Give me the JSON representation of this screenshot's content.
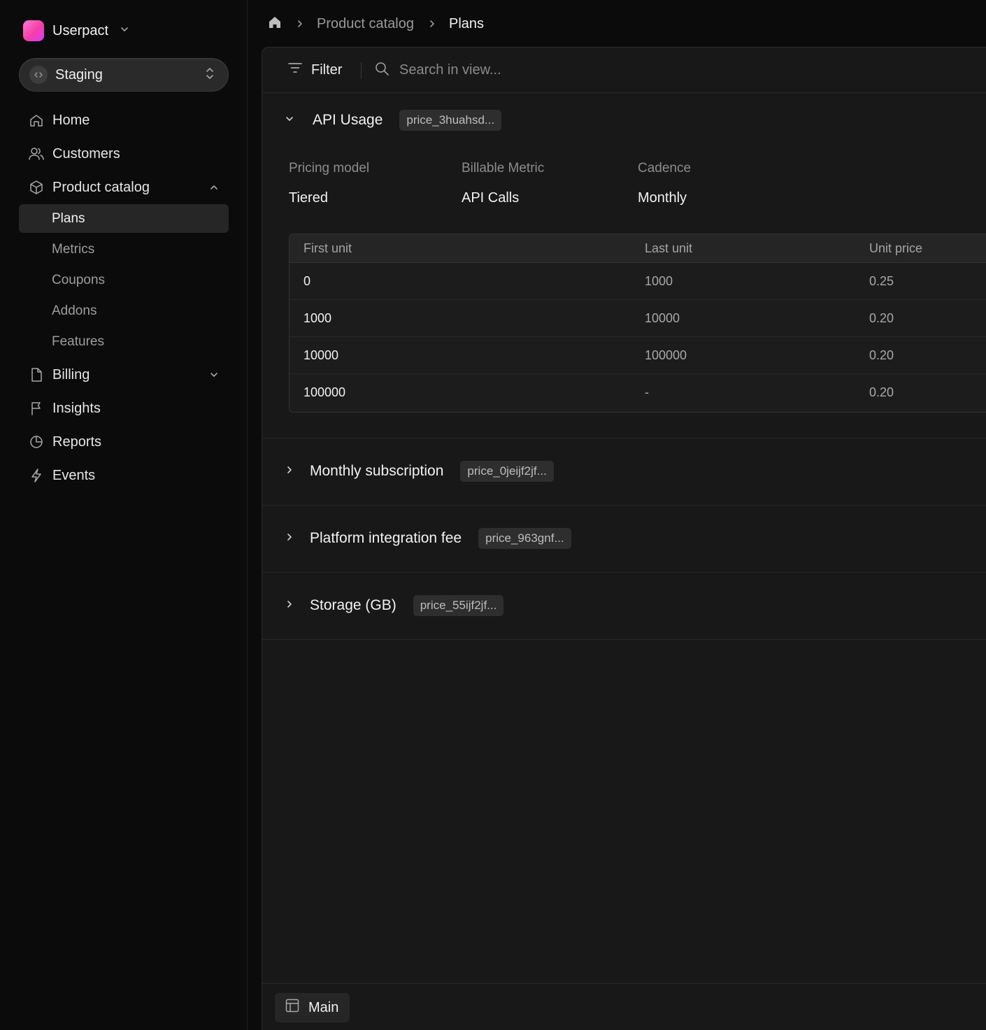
{
  "workspace": {
    "name": "Userpact"
  },
  "environment": {
    "label": "Staging"
  },
  "nav": {
    "home": "Home",
    "customers": "Customers",
    "product_catalog": "Product catalog",
    "product_catalog_children": [
      "Plans",
      "Metrics",
      "Coupons",
      "Addons",
      "Features"
    ],
    "billing": "Billing",
    "insights": "Insights",
    "reports": "Reports",
    "events": "Events"
  },
  "breadcrumb": {
    "items": [
      "Product catalog",
      "Plans"
    ]
  },
  "toolbar": {
    "filter_label": "Filter",
    "search_placeholder": "Search in view..."
  },
  "prices": [
    {
      "name": "API Usage",
      "id": "price_3huahsd...",
      "expanded": true,
      "pricing_model_label": "Pricing model",
      "pricing_model": "Tiered",
      "billable_metric_label": "Billable Metric",
      "billable_metric": "API Calls",
      "cadence_label": "Cadence",
      "cadence": "Monthly",
      "tiers": {
        "headers": [
          "First unit",
          "Last unit",
          "Unit price"
        ],
        "rows": [
          [
            "0",
            "1000",
            "0.25"
          ],
          [
            "1000",
            "10000",
            "0.20"
          ],
          [
            "10000",
            "100000",
            "0.20"
          ],
          [
            "100000",
            "-",
            "0.20"
          ]
        ]
      }
    },
    {
      "name": "Monthly subscription",
      "id": "price_0jeijf2jf...",
      "expanded": false
    },
    {
      "name": "Platform integration fee",
      "id": "price_963gnf...",
      "expanded": false
    },
    {
      "name": "Storage (GB)",
      "id": "price_55ijf2jf...",
      "expanded": false
    }
  ],
  "views": {
    "active": "Main"
  },
  "colors": {
    "background": "#0b0b0b",
    "panel": "#181818",
    "accent_logo": "#f53fa6"
  }
}
